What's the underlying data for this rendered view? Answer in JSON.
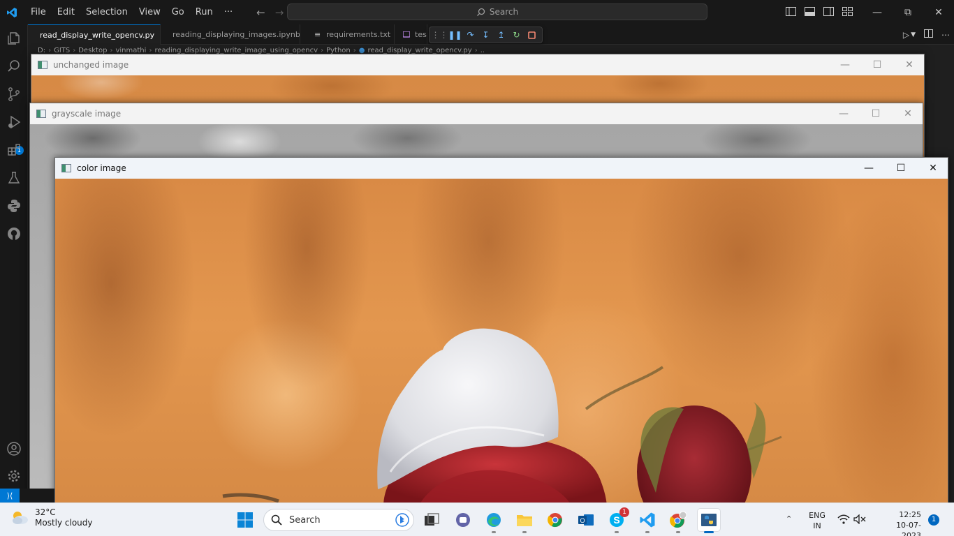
{
  "titlebar": {
    "menu": [
      "File",
      "Edit",
      "Selection",
      "View",
      "Go",
      "Run",
      "···"
    ],
    "search_label": "Search"
  },
  "tabs": [
    {
      "label": "read_display_write_opencv.py",
      "active": true
    },
    {
      "label": "reading_displaying_images.ipynb",
      "active": false
    },
    {
      "label": "requirements.txt",
      "active": false
    },
    {
      "label": "tes",
      "active": false
    }
  ],
  "breadcrumbs": [
    "D:",
    "GITS",
    "Desktop",
    "vinmathi",
    "reading_displaying_write_image_using_opencv",
    "Python",
    "read_display_write_opencv.py",
    "..."
  ],
  "activity": {
    "run_badge": "1"
  },
  "windows": {
    "unchanged": {
      "title": "unchanged image"
    },
    "grayscale": {
      "title": "grayscale image"
    },
    "color": {
      "title": "color image"
    }
  },
  "taskbar": {
    "weather_temp": "32°C",
    "weather_desc": "Mostly cloudy",
    "search_label": "Search",
    "skype_badge": "1",
    "lang_line1": "ENG",
    "lang_line2": "IN",
    "time": "12:25",
    "date": "10-07-2023",
    "notifications": "1"
  },
  "colors": {
    "accent": "#0078d4",
    "titlebar_bg": "#181818",
    "taskbar_bg": "#eef1f6"
  }
}
